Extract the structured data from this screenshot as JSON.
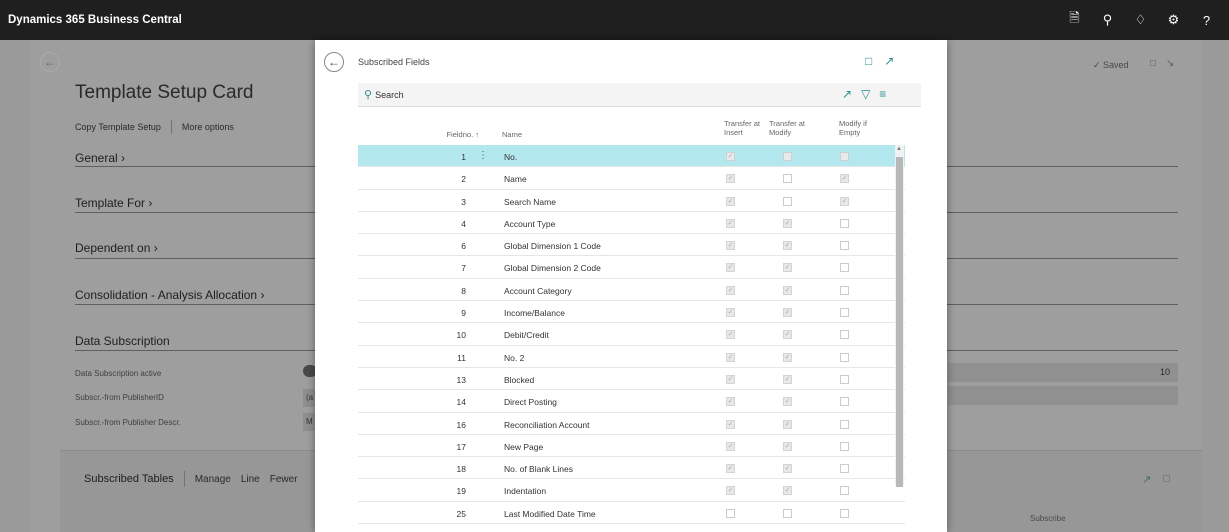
{
  "appbar": {
    "title": "Dynamics 365 Business Central",
    "icons": [
      "document-icon",
      "search-icon",
      "bell-icon",
      "gear-icon",
      "help-icon"
    ]
  },
  "background": {
    "page_title": "Template Setup Card",
    "actions": {
      "copy": "Copy Template Setup",
      "more": "More options"
    },
    "sections": [
      "General",
      "Template For",
      "Dependent on",
      "Consolidation - Analysis Allocation"
    ],
    "data_subscription": {
      "heading": "Data Subscription",
      "fields": [
        {
          "label": "Data Subscription active",
          "value": ""
        },
        {
          "label": "Subscr.-from PublisherID",
          "value": "(a"
        },
        {
          "label": "Subscr.-from Publisher Descr.",
          "value": "M"
        }
      ],
      "right_value": "10"
    },
    "saved": "Saved",
    "subtables": {
      "title": "Subscribed Tables",
      "actions": [
        "Manage",
        "Line",
        "Fewer"
      ],
      "col_subscribe": "Subscribe"
    }
  },
  "modal": {
    "title": "Subscribed Fields",
    "search_label": "Search",
    "columns": {
      "fieldno": "Fieldno. ↑",
      "name": "Name",
      "transfer_insert": "Transfer at Insert",
      "transfer_modify": "Transfer at Modify",
      "modify_if_empty": "Modify if Empty"
    },
    "rows": [
      {
        "no": "1",
        "name": "No.",
        "ti": true,
        "tm": false,
        "me": false,
        "selected": true
      },
      {
        "no": "2",
        "name": "Name",
        "ti": true,
        "tm": false,
        "me": true
      },
      {
        "no": "3",
        "name": "Search Name",
        "ti": true,
        "tm": false,
        "me": true
      },
      {
        "no": "4",
        "name": "Account Type",
        "ti": true,
        "tm": true,
        "me": false
      },
      {
        "no": "6",
        "name": "Global Dimension 1 Code",
        "ti": true,
        "tm": true,
        "me": false
      },
      {
        "no": "7",
        "name": "Global Dimension 2 Code",
        "ti": true,
        "tm": true,
        "me": false
      },
      {
        "no": "8",
        "name": "Account Category",
        "ti": true,
        "tm": true,
        "me": false
      },
      {
        "no": "9",
        "name": "Income/Balance",
        "ti": true,
        "tm": true,
        "me": false
      },
      {
        "no": "10",
        "name": "Debit/Credit",
        "ti": true,
        "tm": true,
        "me": false
      },
      {
        "no": "11",
        "name": "No. 2",
        "ti": true,
        "tm": true,
        "me": false
      },
      {
        "no": "13",
        "name": "Blocked",
        "ti": true,
        "tm": true,
        "me": false
      },
      {
        "no": "14",
        "name": "Direct Posting",
        "ti": true,
        "tm": true,
        "me": false
      },
      {
        "no": "16",
        "name": "Reconciliation Account",
        "ti": true,
        "tm": true,
        "me": false
      },
      {
        "no": "17",
        "name": "New Page",
        "ti": true,
        "tm": true,
        "me": false
      },
      {
        "no": "18",
        "name": "No. of Blank Lines",
        "ti": true,
        "tm": true,
        "me": false
      },
      {
        "no": "19",
        "name": "Indentation",
        "ti": true,
        "tm": true,
        "me": false
      },
      {
        "no": "25",
        "name": "Last Modified Date Time",
        "ti": false,
        "tm": false,
        "me": false
      }
    ]
  }
}
